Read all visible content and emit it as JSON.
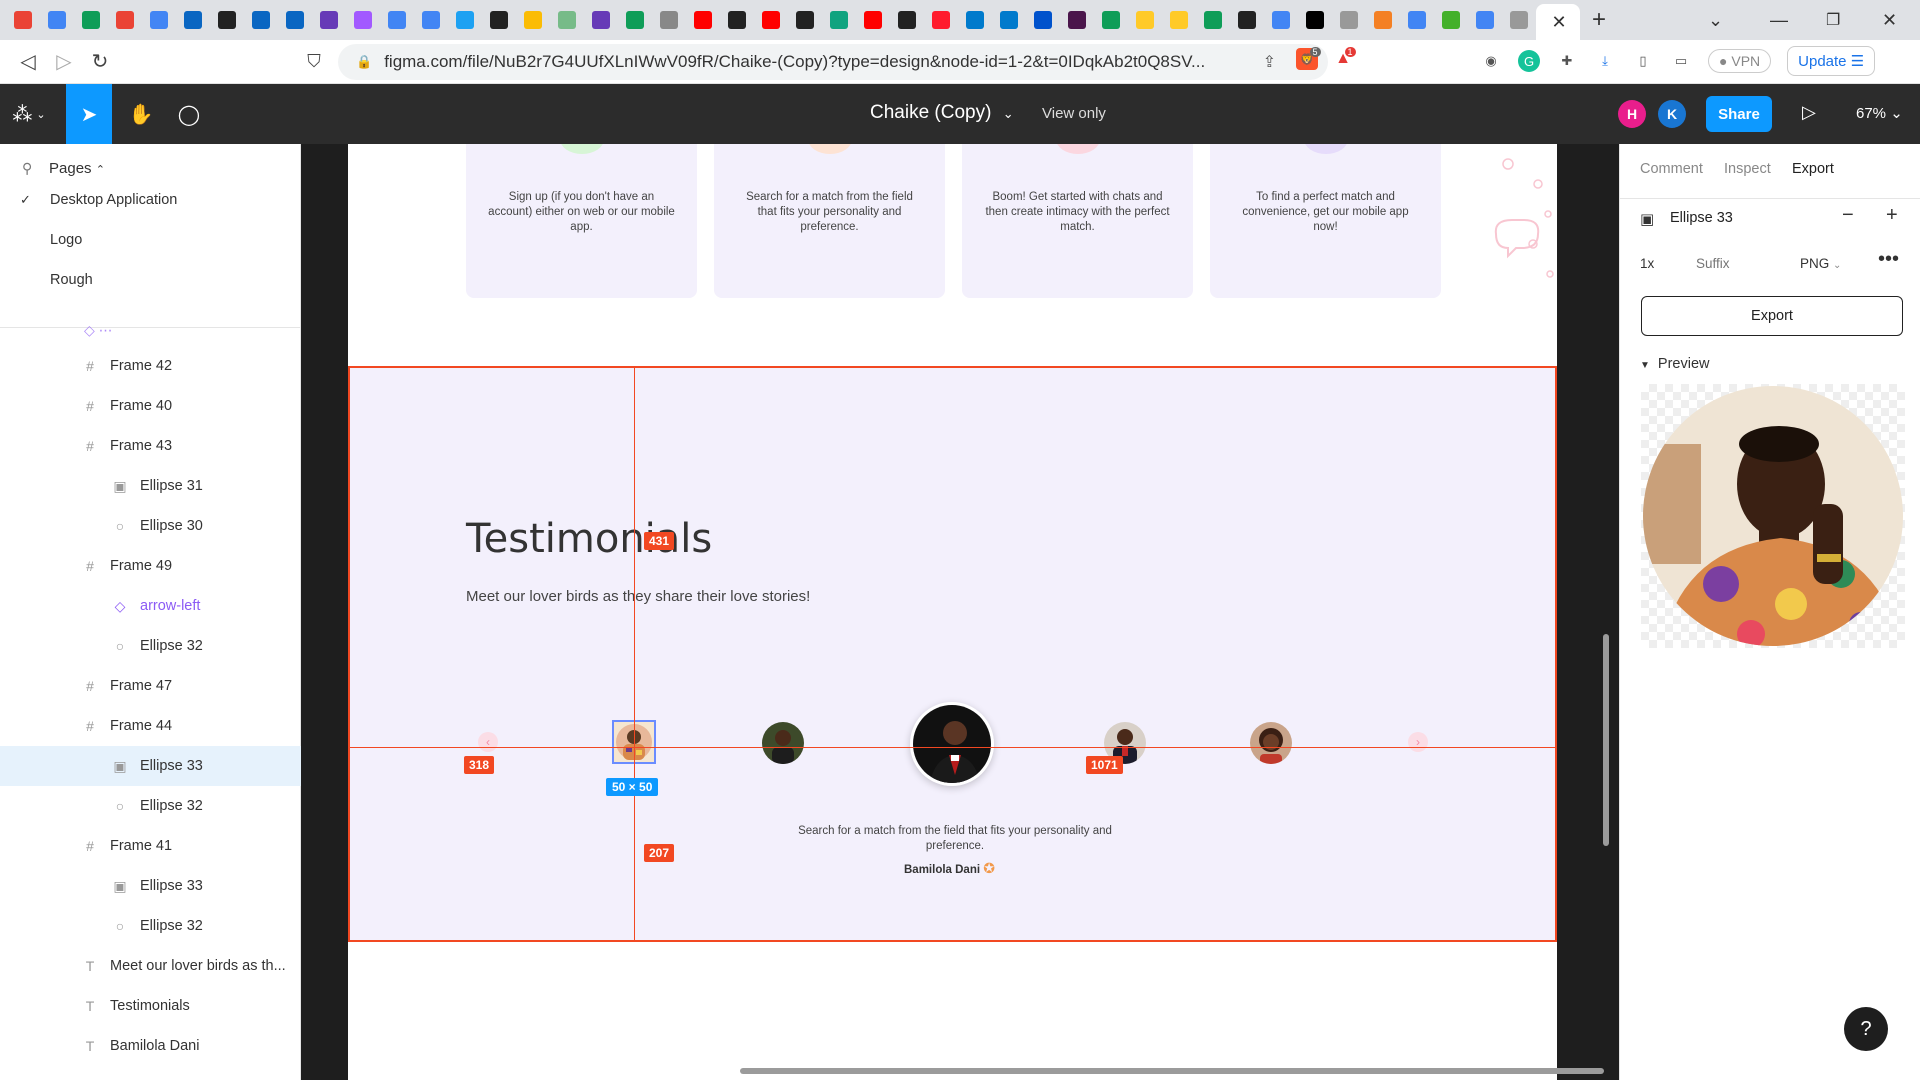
{
  "browser": {
    "tab_icons": [
      "gmail-icon",
      "docs-icon",
      "sheets-icon",
      "gmail-icon",
      "calendar-icon",
      "linkedin-icon",
      "grammarly-icon",
      "linkedin-icon",
      "linkedin-icon",
      "forms-icon",
      "figma-icon",
      "docs-icon",
      "docs-icon",
      "twitter-icon",
      "github-icon",
      "drive-icon",
      "audio-icon",
      "forms-icon",
      "sheets-icon",
      "wiki-icon",
      "youtube-icon",
      "github-icon",
      "youtube-icon",
      "github-icon",
      "chatgpt-icon",
      "youtube-icon",
      "github-icon",
      "opera-icon",
      "vscode-icon",
      "vscode-icon",
      "atlassian-icon",
      "slack-icon",
      "sheets-icon",
      "firebase-icon",
      "firebase-icon",
      "sheets-icon",
      "seven-icon",
      "google-icon",
      "vercel-icon",
      "globe-icon",
      "stack-icon",
      "bot-icon",
      "selenium-icon",
      "google-icon",
      "globe-icon"
    ],
    "url": "figma.com/file/NuB2r7G4UUfXLnIWwV09fR/Chaike-(Copy)?type=design&node-id=1-2&t=0IDqkAb2t0Q8SV...",
    "vpn_label": "VPN",
    "update_label": "Update",
    "brave_count": "5",
    "alert_count": "1"
  },
  "figma_toolbar": {
    "file_title": "Chaike (Copy)",
    "view_only": "View only",
    "avatars": [
      {
        "initial": "H",
        "color": "#e91e8c"
      },
      {
        "initial": "K",
        "color": "#1976d2"
      }
    ],
    "share_label": "Share",
    "zoom": "67%"
  },
  "left_panel": {
    "pages_label": "Pages",
    "pages": [
      {
        "label": "Desktop Application",
        "selected": true
      },
      {
        "label": "Logo",
        "selected": false
      },
      {
        "label": "Rough",
        "selected": false
      }
    ],
    "layers": [
      {
        "label": "Frame 42",
        "type": "frame",
        "indent": 0
      },
      {
        "label": "Frame 40",
        "type": "frame",
        "indent": 0
      },
      {
        "label": "Frame 43",
        "type": "frame",
        "indent": 0
      },
      {
        "label": "Ellipse 31",
        "type": "image",
        "indent": 1
      },
      {
        "label": "Ellipse 30",
        "type": "ellipse",
        "indent": 1
      },
      {
        "label": "Frame 49",
        "type": "frame",
        "indent": 0
      },
      {
        "label": "arrow-left",
        "type": "component",
        "indent": 1
      },
      {
        "label": "Ellipse 32",
        "type": "ellipse",
        "indent": 1
      },
      {
        "label": "Frame 47",
        "type": "frame",
        "indent": 0
      },
      {
        "label": "Frame 44",
        "type": "frame",
        "indent": 0
      },
      {
        "label": "Ellipse 33",
        "type": "image",
        "indent": 1,
        "selected": true
      },
      {
        "label": "Ellipse 32",
        "type": "ellipse",
        "indent": 1
      },
      {
        "label": "Frame 41",
        "type": "frame",
        "indent": 0
      },
      {
        "label": "Ellipse 33",
        "type": "image",
        "indent": 1
      },
      {
        "label": "Ellipse 32",
        "type": "ellipse",
        "indent": 1
      },
      {
        "label": "Meet our lover birds as th...",
        "type": "text",
        "indent": 0
      },
      {
        "label": "Testimonials",
        "type": "text",
        "indent": 0
      },
      {
        "label": "Bamilola Dani",
        "type": "text",
        "indent": 0
      }
    ]
  },
  "canvas": {
    "cards": [
      {
        "text": "Sign up (if you don't have an account) either on web or our mobile app.",
        "bubble": "#d7f5d6"
      },
      {
        "text": "Search for a match from the field that fits your personality and preference.",
        "bubble": "#fde3d4"
      },
      {
        "text": "Boom! Get started with chats and then create intimacy with the perfect match.",
        "bubble": "#fbd7e0"
      },
      {
        "text": "To find a perfect match and convenience, get our mobile app now!",
        "bubble": "#e6dcfb"
      }
    ],
    "testimonials_title": "Testimonials",
    "testimonials_subtitle": "Meet our lover birds as they share their love stories!",
    "quote": "Search for a match from the field that fits your personality and preference.",
    "quote_author": "Bamilola Dani",
    "measure_top": "431",
    "measure_left": "318",
    "measure_right": "1071",
    "measure_bottom": "207",
    "selection_size": "50 × 50"
  },
  "right_panel": {
    "tabs": [
      "Comment",
      "Inspect",
      "Export"
    ],
    "active_tab": "Export",
    "layer_name": "Ellipse 33",
    "scale": "1x",
    "suffix_placeholder": "Suffix",
    "format": "PNG",
    "export_label": "Export",
    "preview_label": "Preview"
  },
  "help_label": "?"
}
